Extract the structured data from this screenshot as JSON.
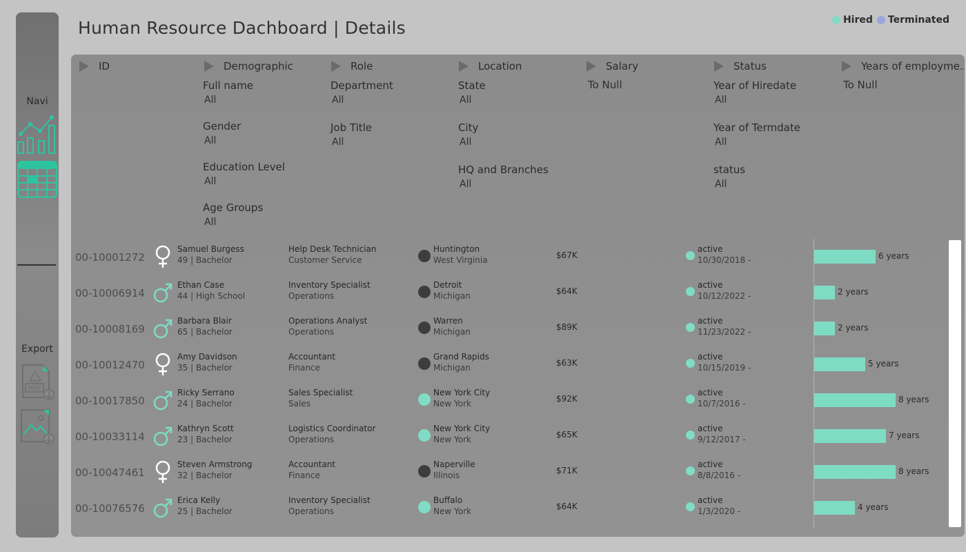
{
  "title": "Human Resource Dachboard | Details",
  "legend": [
    {
      "label": "Hired",
      "color": "#80dcc4"
    },
    {
      "label": "Terminated",
      "color": "#9da4dc"
    }
  ],
  "sidebar": {
    "nav_label": "Navi",
    "nav_icons": [
      "chart-icon",
      "table-icon"
    ],
    "export_label": "Export",
    "export_icons": [
      "pdf-download-icon",
      "image-download-icon"
    ]
  },
  "filters": {
    "headers": [
      "ID",
      "Demographic",
      "Role",
      "Location",
      "Salary",
      "Status",
      "Years of employme.."
    ],
    "demographic": [
      {
        "label": "Full name",
        "value": "All"
      },
      {
        "label": "Gender",
        "value": "All"
      },
      {
        "label": "Education Level",
        "value": "All"
      },
      {
        "label": "Age Groups",
        "value": "All"
      }
    ],
    "role": [
      {
        "label": "Department",
        "value": "All"
      },
      {
        "label": "Job Title",
        "value": "All"
      }
    ],
    "location": [
      {
        "label": "State",
        "value": "All"
      },
      {
        "label": "City",
        "value": "All"
      },
      {
        "label": "HQ and Branches",
        "value": "All"
      }
    ],
    "salary": {
      "value": "To Null"
    },
    "status": [
      {
        "label": "Year of Hiredate",
        "value": "All"
      },
      {
        "label": "Year of Termdate",
        "value": "All"
      },
      {
        "label": "status",
        "value": "All"
      }
    ],
    "years": {
      "value": "To Null"
    }
  },
  "employees": [
    {
      "id": "00-10001272",
      "gender": "female",
      "name": "Samuel Burgess",
      "age_edu": "49 | Bachelor",
      "job": "Help Desk Technician",
      "dept": "Customer Service",
      "loc": "branch",
      "city": "Huntington",
      "state": "West Virginia",
      "salary": "$67K",
      "status": "active",
      "hiredate": "10/30/2018 -",
      "years": 6,
      "years_label": "6 years"
    },
    {
      "id": "00-10006914",
      "gender": "male",
      "name": "Ethan Case",
      "age_edu": "44 | High School",
      "job": "Inventory Specialist",
      "dept": "Operations",
      "loc": "branch",
      "city": "Detroit",
      "state": "Michigan",
      "salary": "$64K",
      "status": "active",
      "hiredate": "10/12/2022 -",
      "years": 2,
      "years_label": "2 years"
    },
    {
      "id": "00-10008169",
      "gender": "male",
      "name": "Barbara Blair",
      "age_edu": "65 | Bachelor",
      "job": "Operations Analyst",
      "dept": "Operations",
      "loc": "branch",
      "city": "Warren",
      "state": "Michigan",
      "salary": "$89K",
      "status": "active",
      "hiredate": "11/23/2022 -",
      "years": 2,
      "years_label": "2 years"
    },
    {
      "id": "00-10012470",
      "gender": "female",
      "name": "Amy Davidson",
      "age_edu": "35 | Bachelor",
      "job": "Accountant",
      "dept": "Finance",
      "loc": "branch",
      "city": "Grand Rapids",
      "state": "Michigan",
      "salary": "$63K",
      "status": "active",
      "hiredate": "10/15/2019 -",
      "years": 5,
      "years_label": "5 years"
    },
    {
      "id": "00-10017850",
      "gender": "male",
      "name": "Ricky Serrano",
      "age_edu": "24 | Bachelor",
      "job": "Sales Specialist",
      "dept": "Sales",
      "loc": "hq",
      "city": "New York City",
      "state": "New York",
      "salary": "$92K",
      "status": "active",
      "hiredate": "10/7/2016 -",
      "years": 8,
      "years_label": "8 years"
    },
    {
      "id": "00-10033114",
      "gender": "male",
      "name": "Kathryn Scott",
      "age_edu": "23 | Bachelor",
      "job": "Logistics Coordinator",
      "dept": "Operations",
      "loc": "hq",
      "city": "New York City",
      "state": "New York",
      "salary": "$65K",
      "status": "active",
      "hiredate": "9/12/2017 -",
      "years": 7,
      "years_label": "7 years"
    },
    {
      "id": "00-10047461",
      "gender": "female",
      "name": "Steven Armstrong",
      "age_edu": "32 | Bachelor",
      "job": "Accountant",
      "dept": "Finance",
      "loc": "branch",
      "city": "Naperville",
      "state": "Illinois",
      "salary": "$71K",
      "status": "active",
      "hiredate": "8/8/2016 -",
      "years": 8,
      "years_label": "8 years"
    },
    {
      "id": "00-10076576",
      "gender": "male",
      "name": "Erica Kelly",
      "age_edu": "25 | Bachelor",
      "job": "Inventory Specialist",
      "dept": "Operations",
      "loc": "hq",
      "city": "Buffalo",
      "state": "New York",
      "salary": "$64K",
      "status": "active",
      "hiredate": "1/3/2020 -",
      "years": 4,
      "years_label": "4 years"
    }
  ],
  "colors": {
    "accent": "#2ec4a0",
    "hq": "#80dcc4",
    "branch": "#3d3d3d",
    "bar": "#7fdcc4",
    "gender_icon": "#ffffff",
    "male_icon": "#80dcc4"
  }
}
